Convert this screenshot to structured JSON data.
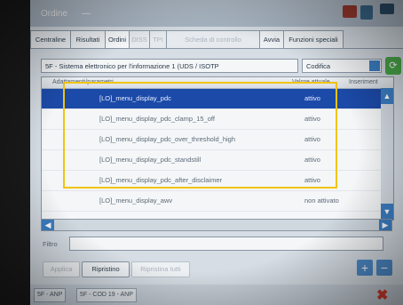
{
  "window": {
    "title": "Ordine",
    "dash": "—"
  },
  "tabs": [
    {
      "label": "Centraline",
      "state": "normal"
    },
    {
      "label": "Risultati",
      "state": "normal"
    },
    {
      "label": "Ordini",
      "state": "active"
    },
    {
      "label": "DISS",
      "state": "disabled"
    },
    {
      "label": "TPI",
      "state": "disabled"
    },
    {
      "label": "Scheda di controllo",
      "state": "disabled"
    },
    {
      "label": "Avvia",
      "state": "normal"
    },
    {
      "label": "Funzioni speciali",
      "state": "normal"
    }
  ],
  "system": {
    "label": "5F - Sistema elettronico per l'informazione 1 (UDS / ISOTP",
    "combo_value": "Codifica"
  },
  "table": {
    "columns": {
      "name": "Adattamenti/parametri",
      "value": "Valore attuale",
      "extra": "Inseriment"
    },
    "rows": [
      {
        "name": "[LO]_menu_display_pdc",
        "value": "attivo",
        "selected": true
      },
      {
        "name": "[LO]_menu_display_pdc_clamp_15_off",
        "value": "attivo",
        "selected": false
      },
      {
        "name": "[LO]_menu_display_pdc_over_threshold_high",
        "value": "attivo",
        "selected": false
      },
      {
        "name": "[LO]_menu_display_pdc_standstill",
        "value": "attivo",
        "selected": false
      },
      {
        "name": "[LO]_menu_display_pdc_after_disclaimer",
        "value": "attivo",
        "selected": false
      },
      {
        "name": "[LO]_menu_display_awv",
        "value": "non attivato",
        "selected": false
      }
    ]
  },
  "filter": {
    "label": "Filtro",
    "value": ""
  },
  "buttons": {
    "apply": "Applica",
    "reset": "Ripristino",
    "reset_all": "Ripristina tutti"
  },
  "status_tabs": [
    "5F - ANP",
    "5F - COD 19 - ANP"
  ],
  "icons": {
    "plus": "+",
    "minus": "−",
    "close": "✖",
    "up": "▲",
    "down": "▼",
    "left": "◀",
    "right": "▶",
    "go": "⟳"
  },
  "colors": {
    "selection": "#1c4aa8",
    "highlight_box": "#f2c40c",
    "accent": "#3c7fc4"
  }
}
